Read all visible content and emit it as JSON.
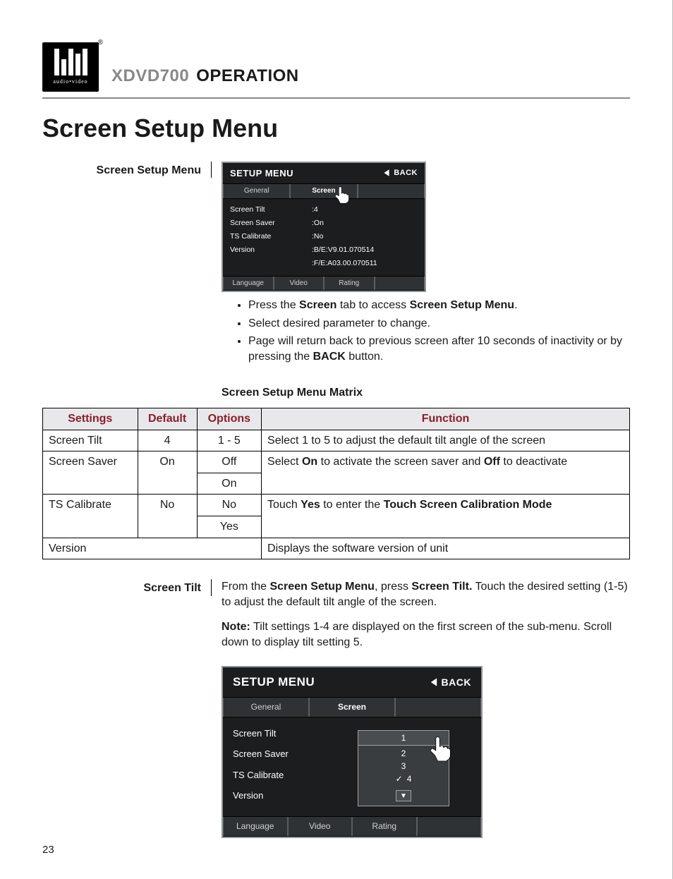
{
  "header": {
    "logo_sub": "audio•video",
    "model": "XDVD700",
    "title": "OPERATION"
  },
  "h1": "Screen Setup Menu",
  "row1": {
    "label": "Screen Setup Menu",
    "panel": {
      "title": "SETUP MENU",
      "back": "BACK",
      "top_tabs": [
        "General",
        "Screen",
        ""
      ],
      "params": [
        "Screen Tilt",
        "Screen Saver",
        "TS Calibrate",
        "Version",
        ""
      ],
      "values": [
        ":4",
        ":On",
        ":No",
        ":B/E:V9.01.070514",
        ":F/E:A03.00.070511"
      ],
      "bottom_tabs": [
        "Language",
        "Video",
        "Rating",
        ""
      ]
    },
    "bullets_html": [
      "Press the <span class=\"b\">Screen</span> tab to access <span class=\"b\">Screen Setup Menu</span>.",
      "Select desired parameter to change.",
      "Page will return back to previous screen after 10 seconds of inactivity or by pressing the <span class=\"b\">BACK</span> button."
    ]
  },
  "matrix": {
    "heading": "Screen Setup Menu Matrix",
    "headers": [
      "Settings",
      "Default",
      "Options",
      "Function"
    ],
    "rows_html": [
      {
        "setting": "Screen Tilt",
        "default": "4",
        "options": [
          "1 - 5"
        ],
        "function": "Select 1 to 5 to adjust the default tilt angle of the screen"
      },
      {
        "setting": "Screen Saver",
        "default": "On",
        "options": [
          "Off",
          "On"
        ],
        "function": "Select <span class=\"b\">On</span> to activate the screen saver and <span class=\"b\">Off</span> to deactivate"
      },
      {
        "setting": "TS Calibrate",
        "default": "No",
        "options": [
          "No",
          "Yes"
        ],
        "function": "Touch <span class=\"b\">Yes</span> to enter the <span class=\"b\">Touch Screen Calibration Mode</span>"
      },
      {
        "setting": "Version",
        "default": "",
        "options": [],
        "function": "Displays the software version of unit"
      }
    ]
  },
  "row2": {
    "label": "Screen Tilt",
    "para1_html": "From the <span class=\"b\">Screen Setup Menu</span>, press <span class=\"b\">Screen Tilt.</span> Touch the desired setting (1-5) to adjust the default tilt angle of the screen.",
    "para2_html": "<span class=\"b\">Note:</span> Tilt settings 1-4 are displayed on the first screen of the sub-menu. Scroll down to display tilt setting 5.",
    "panel": {
      "title": "SETUP MENU",
      "back": "BACK",
      "top_tabs": [
        "General",
        "Screen",
        ""
      ],
      "params": [
        "Screen Tilt",
        "Screen Saver",
        "TS Calibrate",
        "Version"
      ],
      "submenu": {
        "highlight": "1",
        "items": [
          "2",
          "3",
          "4"
        ],
        "checked": "4"
      },
      "bottom_tabs": [
        "Language",
        "Video",
        "Rating",
        ""
      ]
    }
  },
  "page_number": "23"
}
